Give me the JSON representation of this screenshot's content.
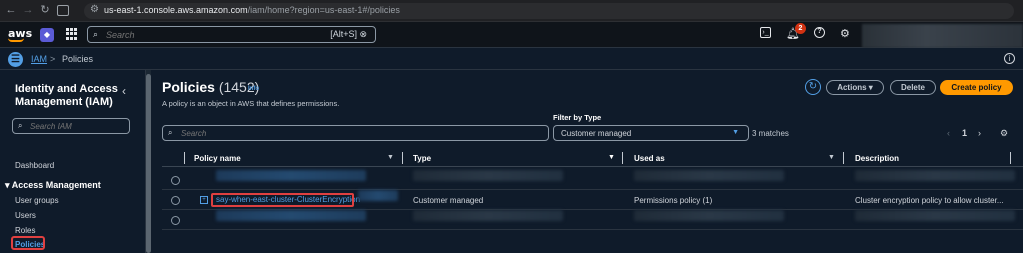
{
  "browser": {
    "url_host": "us-east-1.console.aws.amazon.com",
    "url_path": "/iam/home?region=us-east-1#/policies"
  },
  "topnav": {
    "logo": "aws",
    "search_placeholder": "Search",
    "search_shortcut": "[Alt+S]",
    "notification_count": "2"
  },
  "breadcrumb": {
    "items": [
      "IAM",
      "Policies"
    ],
    "separator": ">"
  },
  "sidebar": {
    "title": "Identity and Access Management (IAM)",
    "search_placeholder": "Search IAM",
    "dashboard": "Dashboard",
    "section": "Access Management",
    "items": [
      "User groups",
      "Users",
      "Roles",
      "Policies"
    ],
    "active": "Policies"
  },
  "main": {
    "title": "Policies",
    "count": "(1452)",
    "info": "Info",
    "description": "A policy is an object in AWS that defines permissions.",
    "buttons": {
      "actions": "Actions",
      "delete": "Delete",
      "create": "Create policy"
    },
    "search_placeholder": "Search",
    "filter_label": "Filter by Type",
    "filter_value": "Customer managed",
    "matches": "3 matches",
    "page": "1",
    "columns": [
      "Policy name",
      "Type",
      "Used as",
      "Description"
    ],
    "rows": [
      {
        "name": "",
        "type": "",
        "used_as": "",
        "description": ""
      },
      {
        "name": "say-when-east-cluster-ClusterEncryption",
        "type": "Customer managed",
        "used_as": "Permissions policy (1)",
        "description": "Cluster encryption policy to allow cluster..."
      },
      {
        "name": "",
        "type": "",
        "used_as": "",
        "description": ""
      }
    ]
  },
  "colors": {
    "accent": "#539fe5",
    "primary_button": "#ff9900",
    "background": "#0f1b2a",
    "highlight": "#e04040"
  }
}
